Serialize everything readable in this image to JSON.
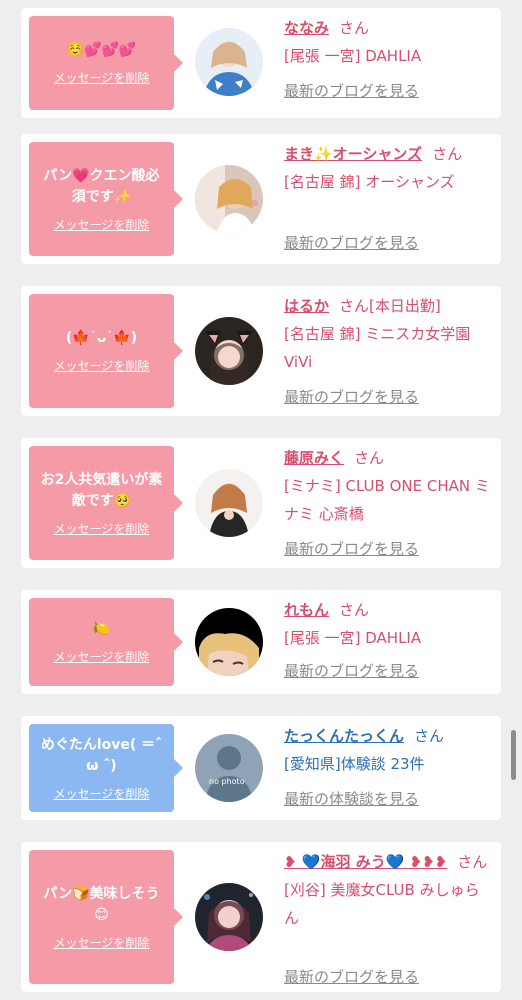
{
  "colors": {
    "accent_pink": "#f59aa7",
    "accent_blue": "#8cb8f2",
    "text_pink": "#d94d6d",
    "text_blue": "#2c6fb4"
  },
  "cards": [
    {
      "message": "☺️💕💕💕",
      "delete_label": "メッセージを削除",
      "name": "ななみ",
      "honorific": "さん",
      "shop": "[尾張 一宮] DAHLIA",
      "link": "最新のブログを見る"
    },
    {
      "message": "パン💗クエン酸必須です✨",
      "delete_label": "メッセージを削除",
      "name": "まき✨オーシャンズ",
      "honorific": "さん",
      "shop": "[名古屋 錦] オーシャンズ",
      "link": "最新のブログを見る"
    },
    {
      "message": "(🍁˙ᴗ˙🍁)",
      "delete_label": "メッセージを削除",
      "name": "はるか",
      "honorific": "さん[本日出勤]",
      "shop": "[名古屋 錦] ミニスカ女学園ViVi",
      "link": "最新のブログを見る"
    },
    {
      "message": "お2人共気遣いが素敵です🥺",
      "delete_label": "メッセージを削除",
      "name": "藤原みく",
      "honorific": "さん",
      "shop": "[ミナミ] CLUB ONE CHAN ミナミ 心斎橋",
      "link": "最新のブログを見る"
    },
    {
      "message": "🍋",
      "delete_label": "メッセージを削除",
      "name": "れもん",
      "honorific": "さん",
      "shop": "[尾張 一宮] DAHLIA",
      "link": "最新のブログを見る"
    },
    {
      "message": "めぐたんlove( ＝ˆ ω ˆ)",
      "delete_label": "メッセージを削除",
      "name": "たっくんたっくん",
      "honorific": "さん",
      "shop": "[愛知県]体験談 23件",
      "link": "最新の体験談を見る",
      "avatar_text": "no photo"
    },
    {
      "message": "パン🍞美味しそう😊",
      "delete_label": "メッセージを削除",
      "name": "❥ 💙海羽 みう💙 ❥❥❥",
      "honorific": "さん",
      "shop": "[刈谷] 美魔女CLUB みしゅらん",
      "link": "最新のブログを見る"
    }
  ]
}
